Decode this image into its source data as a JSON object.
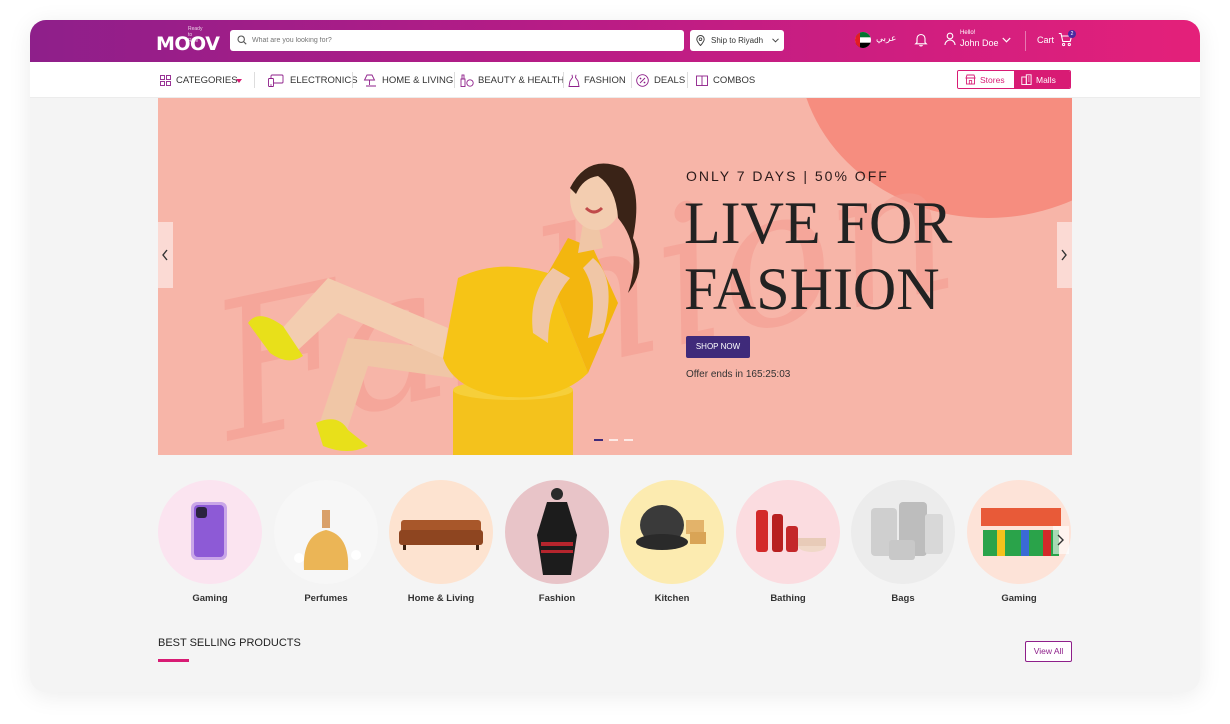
{
  "header": {
    "logo_text": "MOOV",
    "logo_tagline": "Ready to Ride",
    "search_placeholder": "What are you looking for?",
    "ship_to": "Ship to Riyadh",
    "language": "عربي",
    "greeting": "Hello!",
    "user_name": "John Doe",
    "cart_label": "Cart",
    "cart_count": "2"
  },
  "nav": {
    "categories": "CATEGORIES",
    "items": [
      "ELECTRONICS",
      "HOME & LIVING",
      "BEAUTY & HEALTH",
      "FASHION",
      "DEALS",
      "COMBOS"
    ],
    "stores": "Stores",
    "malls": "Malls"
  },
  "banner": {
    "subtitle": "ONLY  7  DAYS | 50% OFF",
    "title_line1": "LIVE FOR",
    "title_line2": "FASHION",
    "cta": "SHOP NOW",
    "offer": "Offer ends in 165:25:03",
    "background_word": "Fashion"
  },
  "categories": [
    "Gaming",
    "Perfumes",
    "Home & Living",
    "Fashion",
    "Kitchen",
    "Bathing",
    "Bags",
    "Gaming"
  ],
  "best_selling": {
    "title": "BEST SELLING PRODUCTS",
    "view_all": "View All"
  },
  "colors": {
    "brand_purple": "#8e1f8a",
    "brand_pink": "#d81b74",
    "banner_bg": "#f7b5a8",
    "cta_bg": "#3f2a7a"
  }
}
